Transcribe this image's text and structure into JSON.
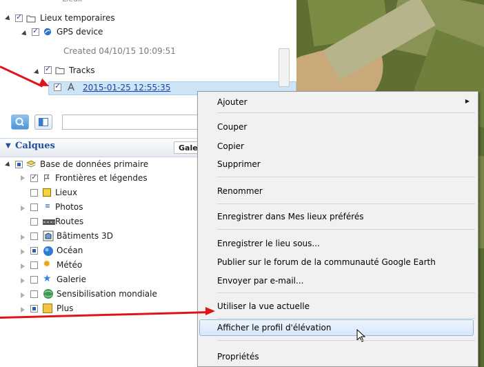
{
  "places": {
    "top_partial_label": "Lieux",
    "temp_places": "Lieux temporaires",
    "gps_device": "GPS device",
    "created_note": "Created 04/10/15 10:09:51",
    "tracks": "Tracks",
    "track_item": "2015-01-25 12:55:35"
  },
  "layers": {
    "header": "Calques",
    "gallery_tab": "Gale",
    "items": [
      {
        "label": "Base de données primaire"
      },
      {
        "label": "Frontières et légendes"
      },
      {
        "label": "Lieux"
      },
      {
        "label": "Photos"
      },
      {
        "label": "Routes"
      },
      {
        "label": "Bâtiments 3D"
      },
      {
        "label": "Océan"
      },
      {
        "label": "Météo"
      },
      {
        "label": "Galerie"
      },
      {
        "label": "Sensibilisation mondiale"
      },
      {
        "label": "Plus"
      }
    ]
  },
  "context_menu": {
    "items": [
      {
        "label": "Ajouter"
      },
      {
        "label": "Couper"
      },
      {
        "label": "Copier"
      },
      {
        "label": "Supprimer"
      },
      {
        "label": "Renommer"
      },
      {
        "label": "Enregistrer dans Mes lieux préférés"
      },
      {
        "label": "Enregistrer le lieu sous..."
      },
      {
        "label": "Publier sur le forum de la communauté Google Earth"
      },
      {
        "label": "Envoyer par e-mail..."
      },
      {
        "label": "Utiliser la vue actuelle"
      },
      {
        "label": "Afficher le profil d'élévation"
      },
      {
        "label": "Propriétés"
      }
    ],
    "highlighted": "Afficher le profil d'élévation"
  },
  "colors": {
    "annotation_arrow": "#e0131b",
    "selection": "#cde4f7",
    "menu_bg": "#f1f1f1",
    "link": "#1a3fa8",
    "layers_header": "#1f4e9c"
  }
}
